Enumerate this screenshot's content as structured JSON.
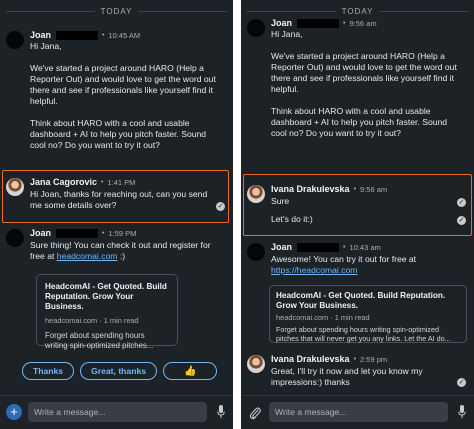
{
  "left": {
    "divider": "TODAY",
    "messages": [
      {
        "sender": "Joan",
        "time": "10:45 AM",
        "paragraphs": [
          "Hi Jana,",
          "We've started a project around HARO (Help a Reporter Out) and would love to get the word out there and see if professionals like yourself find it helpful.",
          "Think about HARO with a cool and usable dashboard + AI to help you pitch faster. Sound cool no? Do you want to try it out?"
        ]
      },
      {
        "sender": "Jana Cagorovic",
        "time": "1:41 PM",
        "text": "Hi Joan, thanks for reaching out, can you send me some details over?"
      },
      {
        "sender": "Joan",
        "time": "1:59 PM",
        "text": "Sure thing! You can check it out and register for free at",
        "link": "headcomai.com",
        "after_link": " :)"
      }
    ],
    "card": {
      "title": "HeadcomAI - Get Quoted. Build Reputation. Grow Your Business.",
      "meta": "headcomai.com · 1 min read",
      "desc": "Forget about spending hours writing spin-optimized pitches..."
    },
    "replies": [
      "Thanks",
      "Great, thanks",
      "👍"
    ],
    "composer_placeholder": "Write a message..."
  },
  "right": {
    "divider": "TODAY",
    "messages": [
      {
        "sender": "Joan",
        "time": "9:56 am",
        "paragraphs": [
          "Hi Jana,",
          "We've started a project around HARO (Help a Reporter Out) and would love to get the word out there and see if professionals like yourself find it helpful.",
          "Think about HARO with a cool and usable dashboard + AI to help you pitch faster. Sound cool no? Do you want to try it out?"
        ]
      },
      {
        "sender": "Ivana Drakulevska",
        "time": "9:56 am",
        "lines": [
          "Sure",
          "Let's do it:)"
        ]
      },
      {
        "sender": "Joan",
        "time": "10:43 am",
        "text": "Awesome! You can try it out for free at",
        "link": "https://headcomai.com"
      },
      {
        "sender": "Ivana Drakulevska",
        "time": "2:59 pm",
        "text": "Great, I'll try it now and let you know my impressions:) thanks"
      }
    ],
    "card": {
      "title": "HeadcomAI - Get Quoted. Build Reputation. Grow Your Business.",
      "meta": "headcomai.com · 1 min read",
      "desc": "Forget about spending hours writing spin-optimized pitches that will never get you any links. Let the AI do..."
    },
    "composer_placeholder": "Write a message..."
  },
  "colors": {
    "background": "#1d2226",
    "highlight": "#e86b28",
    "link": "#71b7fb"
  }
}
